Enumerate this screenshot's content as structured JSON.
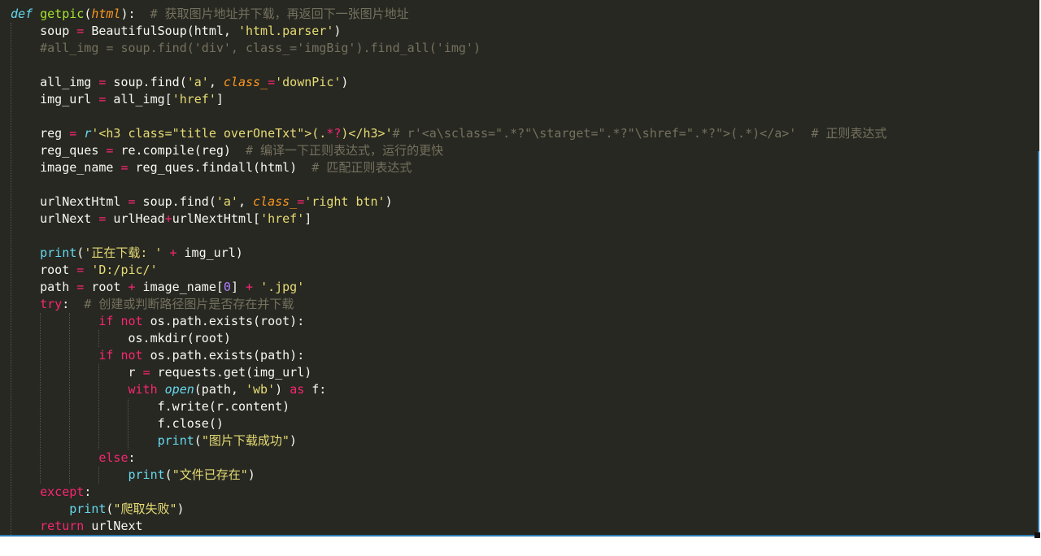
{
  "editor": {
    "theme": {
      "background": "#272822",
      "foreground": "#f8f8f2",
      "keyword": "#f92672",
      "keyword_blue": "#66d9ef",
      "function": "#a6e22e",
      "parameter": "#fd971f",
      "string": "#e6db74",
      "comment": "#75715e",
      "number": "#ae81ff",
      "accent": "#2a7ab0"
    },
    "lines": [
      [
        [
          "kwi",
          "def"
        ],
        [
          "plain",
          " "
        ],
        [
          "fn",
          "getpic"
        ],
        [
          "plain",
          "("
        ],
        [
          "param",
          "html"
        ],
        [
          "plain",
          "):  "
        ],
        [
          "com",
          "# 获取图片地址并下载，再返回下一张图片地址"
        ]
      ],
      [
        [
          "plain",
          "    soup "
        ],
        [
          "op",
          "="
        ],
        [
          "plain",
          " BeautifulSoup(html, "
        ],
        [
          "str",
          "'html.parser'"
        ],
        [
          "plain",
          ")"
        ]
      ],
      [
        [
          "com",
          "    #all_img = soup.find('div', class_='imgBig').find_all('img')"
        ]
      ],
      [
        [
          "plain",
          ""
        ]
      ],
      [
        [
          "plain",
          "    all_img "
        ],
        [
          "op",
          "="
        ],
        [
          "plain",
          " soup.find("
        ],
        [
          "str",
          "'a'"
        ],
        [
          "plain",
          ", "
        ],
        [
          "param",
          "class_"
        ],
        [
          "op",
          "="
        ],
        [
          "str",
          "'downPic'"
        ],
        [
          "plain",
          ")"
        ]
      ],
      [
        [
          "plain",
          "    img_url "
        ],
        [
          "op",
          "="
        ],
        [
          "plain",
          " all_img["
        ],
        [
          "str",
          "'href'"
        ],
        [
          "plain",
          "]"
        ]
      ],
      [
        [
          "plain",
          ""
        ]
      ],
      [
        [
          "plain",
          "    reg "
        ],
        [
          "op",
          "="
        ],
        [
          "plain",
          " "
        ],
        [
          "kwi",
          "r"
        ],
        [
          "str",
          "'<h3 class=\"title overOneTxt\">(."
        ],
        [
          "op",
          "*?"
        ],
        [
          "str",
          ")</h3>'"
        ],
        [
          "com",
          "# r'<a\\sclass=\".*?\"\\starget=\".*?\"\\shref=\".*?\">(.*)</a>'  # 正则表达式"
        ]
      ],
      [
        [
          "plain",
          "    reg_ques "
        ],
        [
          "op",
          "="
        ],
        [
          "plain",
          " re.compile(reg)  "
        ],
        [
          "com",
          "# 编译一下正则表达式，运行的更快"
        ]
      ],
      [
        [
          "plain",
          "    image_name "
        ],
        [
          "op",
          "="
        ],
        [
          "plain",
          " reg_ques.findall(html)  "
        ],
        [
          "com",
          "# 匹配正则表达式"
        ]
      ],
      [
        [
          "plain",
          ""
        ]
      ],
      [
        [
          "plain",
          "    urlNextHtml "
        ],
        [
          "op",
          "="
        ],
        [
          "plain",
          " soup.find("
        ],
        [
          "str",
          "'a'"
        ],
        [
          "plain",
          ", "
        ],
        [
          "param",
          "class_"
        ],
        [
          "op",
          "="
        ],
        [
          "str",
          "'right btn'"
        ],
        [
          "plain",
          ")"
        ]
      ],
      [
        [
          "plain",
          "    urlNext "
        ],
        [
          "op",
          "="
        ],
        [
          "plain",
          " urlHead"
        ],
        [
          "op",
          "+"
        ],
        [
          "plain",
          "urlNextHtml["
        ],
        [
          "str",
          "'href'"
        ],
        [
          "plain",
          "]"
        ]
      ],
      [
        [
          "plain",
          ""
        ]
      ],
      [
        [
          "plain",
          "    "
        ],
        [
          "builtin",
          "print"
        ],
        [
          "plain",
          "("
        ],
        [
          "str",
          "'正在下载: '"
        ],
        [
          "plain",
          " "
        ],
        [
          "op",
          "+"
        ],
        [
          "plain",
          " img_url)"
        ]
      ],
      [
        [
          "plain",
          "    root "
        ],
        [
          "op",
          "="
        ],
        [
          "plain",
          " "
        ],
        [
          "str",
          "'D:/pic/'"
        ]
      ],
      [
        [
          "plain",
          "    path "
        ],
        [
          "op",
          "="
        ],
        [
          "plain",
          " root "
        ],
        [
          "op",
          "+"
        ],
        [
          "plain",
          " image_name["
        ],
        [
          "num",
          "0"
        ],
        [
          "plain",
          "] "
        ],
        [
          "op",
          "+"
        ],
        [
          "plain",
          " "
        ],
        [
          "str",
          "'.jpg'"
        ]
      ],
      [
        [
          "plain",
          "    "
        ],
        [
          "kw",
          "try"
        ],
        [
          "plain",
          ":  "
        ],
        [
          "com",
          "# 创建或判断路径图片是否存在并下载"
        ]
      ],
      [
        [
          "plain",
          "            "
        ],
        [
          "kw",
          "if"
        ],
        [
          "plain",
          " "
        ],
        [
          "kw",
          "not"
        ],
        [
          "plain",
          " os.path.exists(root):"
        ]
      ],
      [
        [
          "plain",
          "                os.mkdir(root)"
        ]
      ],
      [
        [
          "plain",
          "            "
        ],
        [
          "kw",
          "if"
        ],
        [
          "plain",
          " "
        ],
        [
          "kw",
          "not"
        ],
        [
          "plain",
          " os.path.exists(path):"
        ]
      ],
      [
        [
          "plain",
          "                r "
        ],
        [
          "op",
          "="
        ],
        [
          "plain",
          " requests.get(img_url)"
        ]
      ],
      [
        [
          "plain",
          "                "
        ],
        [
          "kw",
          "with"
        ],
        [
          "plain",
          " "
        ],
        [
          "kwi",
          "open"
        ],
        [
          "plain",
          "(path, "
        ],
        [
          "str",
          "'wb'"
        ],
        [
          "plain",
          ") "
        ],
        [
          "kw",
          "as"
        ],
        [
          "plain",
          " f:"
        ]
      ],
      [
        [
          "plain",
          "                    f.write(r.content)"
        ]
      ],
      [
        [
          "plain",
          "                    f.close()"
        ]
      ],
      [
        [
          "plain",
          "                    "
        ],
        [
          "builtin",
          "print"
        ],
        [
          "plain",
          "("
        ],
        [
          "str",
          "\"图片下载成功\""
        ],
        [
          "plain",
          ")"
        ]
      ],
      [
        [
          "plain",
          "            "
        ],
        [
          "kw",
          "else"
        ],
        [
          "plain",
          ":"
        ]
      ],
      [
        [
          "plain",
          "                "
        ],
        [
          "builtin",
          "print"
        ],
        [
          "plain",
          "("
        ],
        [
          "str",
          "\"文件已存在\""
        ],
        [
          "plain",
          ")"
        ]
      ],
      [
        [
          "plain",
          "    "
        ],
        [
          "kw",
          "except"
        ],
        [
          "plain",
          ":"
        ]
      ],
      [
        [
          "plain",
          "        "
        ],
        [
          "builtin",
          "print"
        ],
        [
          "plain",
          "("
        ],
        [
          "str",
          "\"爬取失败\""
        ],
        [
          "plain",
          ")"
        ]
      ],
      [
        [
          "plain",
          "    "
        ],
        [
          "kw",
          "return"
        ],
        [
          "plain",
          " urlNext"
        ]
      ]
    ]
  }
}
